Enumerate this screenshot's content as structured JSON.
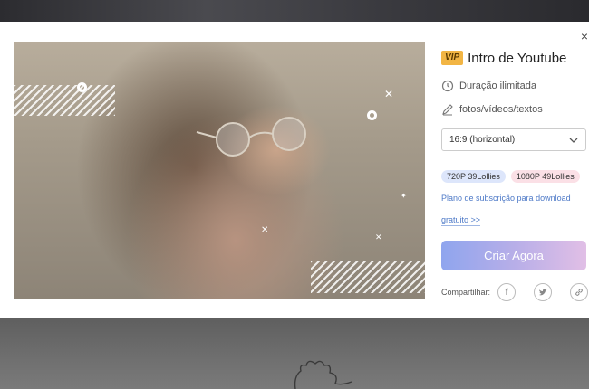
{
  "modal": {
    "close_glyph": "×",
    "template": {
      "vip_badge": "VIP",
      "title": "Intro de Youtube",
      "features": [
        {
          "icon": "clock-icon",
          "label": "Duração ilimitada"
        },
        {
          "icon": "pen-icon",
          "label": "fotos/vídeos/textos"
        }
      ],
      "aspect_select": {
        "selected": "16:9 (horizontal)"
      },
      "resolution_badges": [
        "720P 39Lollies",
        "1080P 49Lollies"
      ],
      "subscription_link": [
        "Plano de subscrição para download",
        "gratuito >>"
      ],
      "create_button": "Criar Agora",
      "share": {
        "label": "Compartilhar:",
        "icons": [
          "facebook-icon",
          "twitter-icon",
          "link-icon"
        ]
      }
    }
  },
  "colors": {
    "vip_badge": "#f2b544",
    "link": "#4d79c7",
    "cta_gradient_start": "#8fa5ee",
    "cta_gradient_end": "#e1bfe6",
    "badge_720": "#dde6fb",
    "badge_1080": "#fbe0e6"
  }
}
